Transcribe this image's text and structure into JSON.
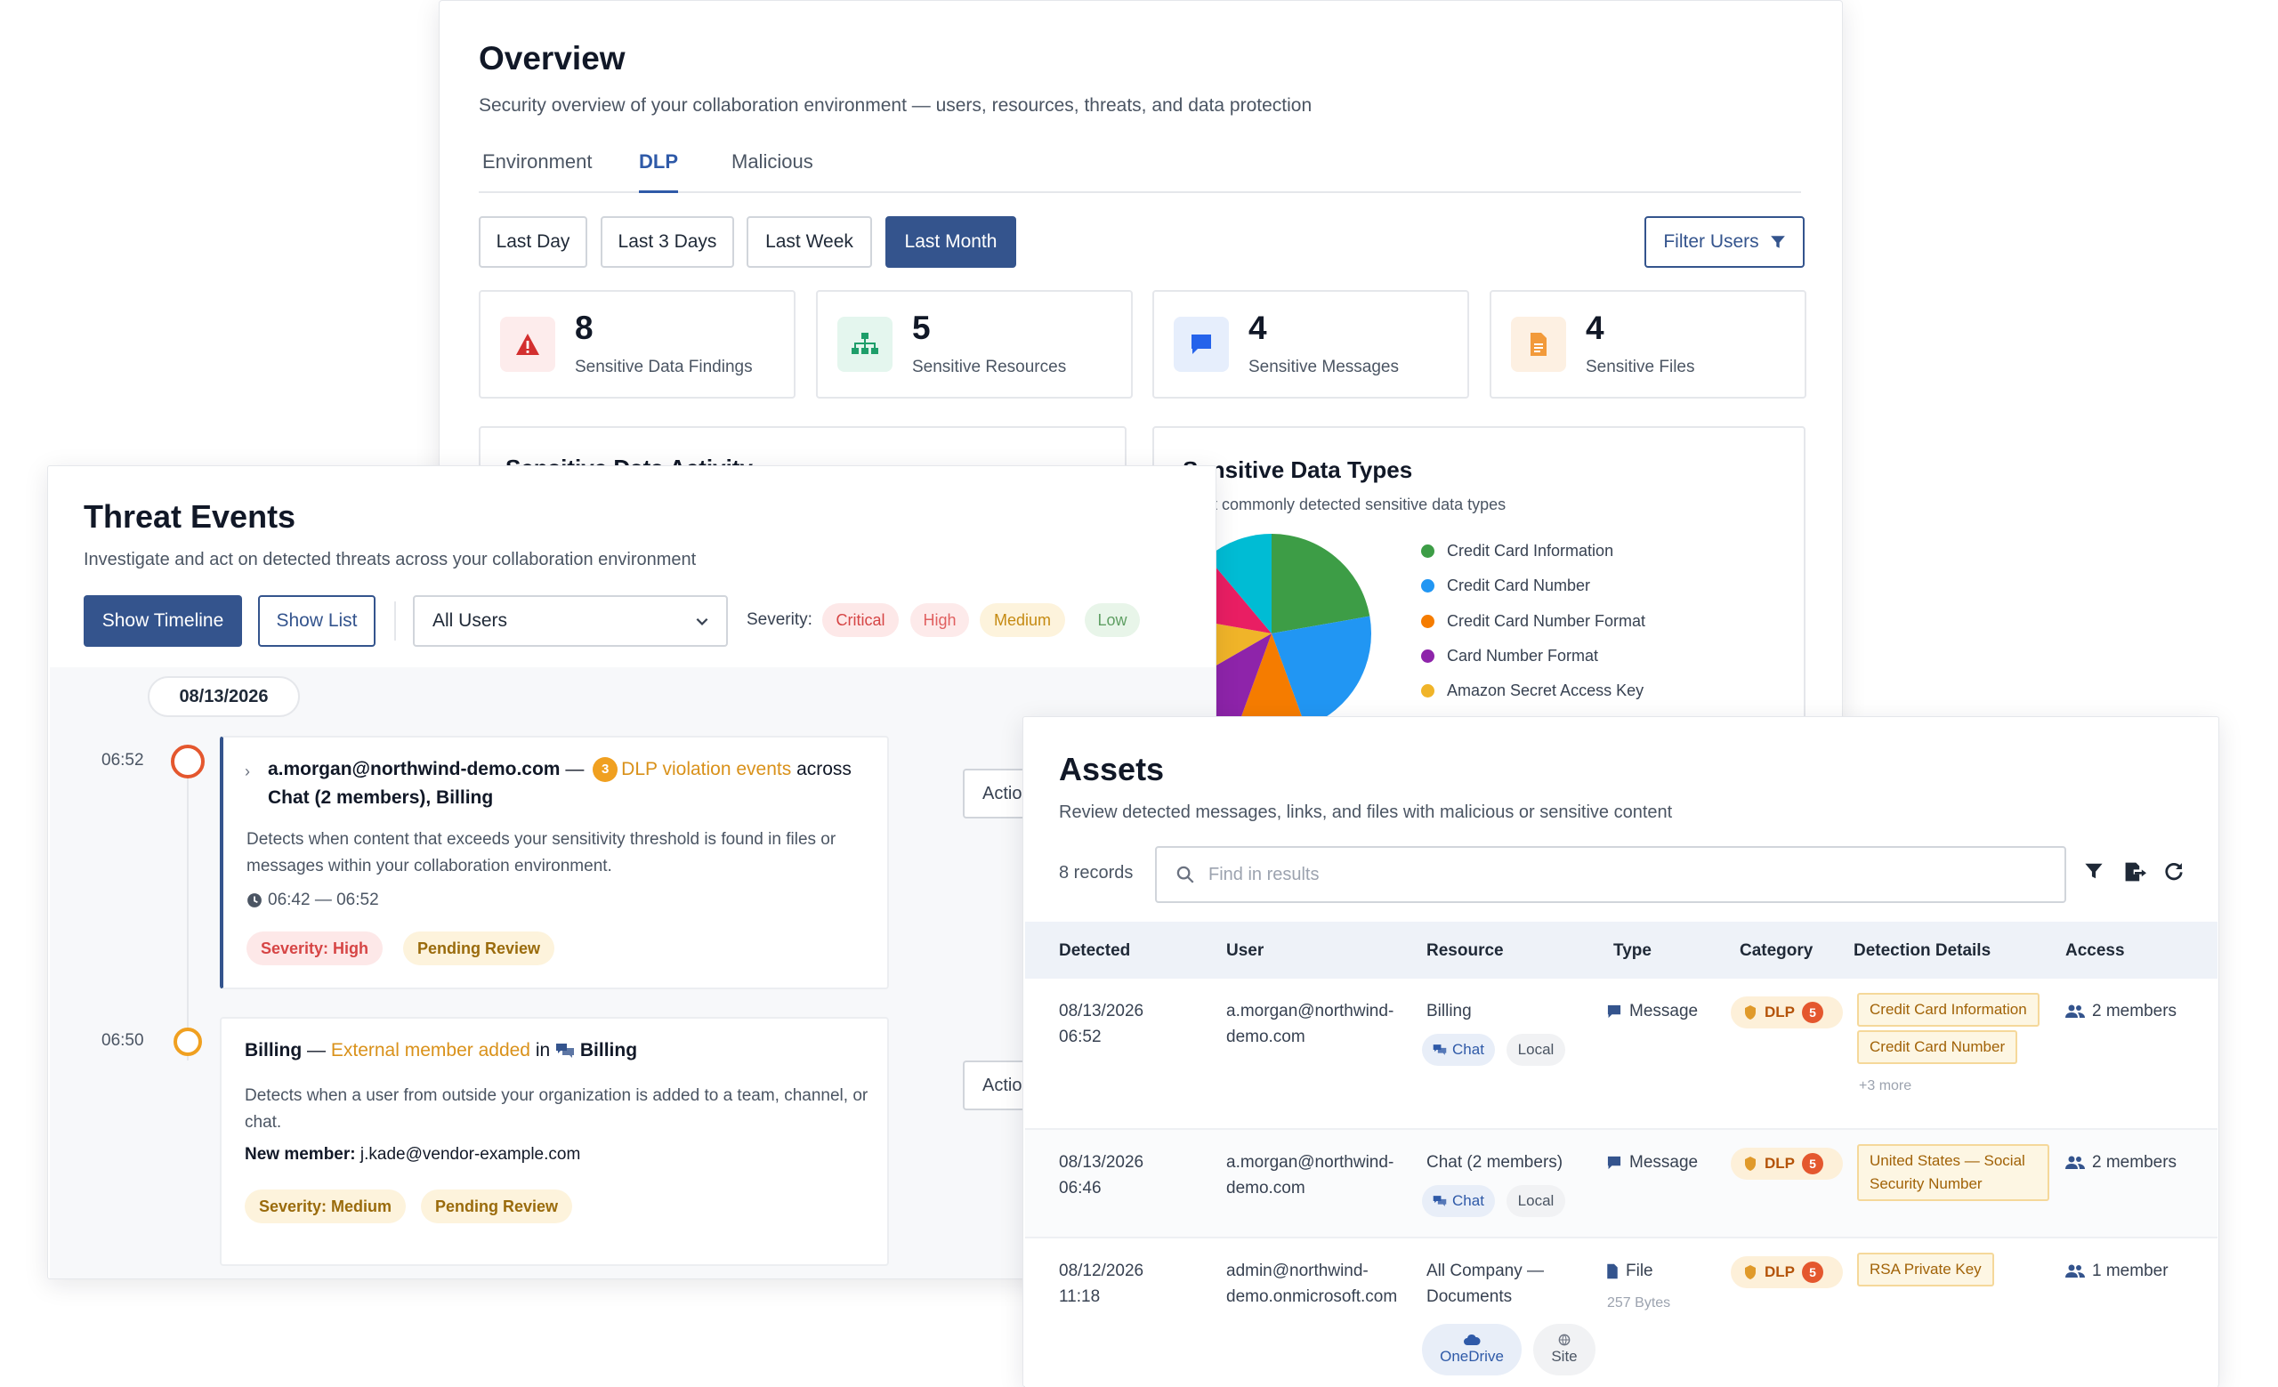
{
  "overview": {
    "title": "Overview",
    "subtitle": "Security overview of your collaboration environment — users, resources, threats, and data protection",
    "tabs": [
      {
        "label": "Environment"
      },
      {
        "label": "DLP"
      },
      {
        "label": "Malicious"
      }
    ],
    "active_tab": "DLP",
    "ranges": [
      {
        "label": "Last Day"
      },
      {
        "label": "Last 3 Days"
      },
      {
        "label": "Last Week"
      },
      {
        "label": "Last Month"
      }
    ],
    "active_range": "Last Month",
    "filter_label": "Filter Users",
    "stats": [
      {
        "value": "8",
        "label": "Sensitive Data Findings",
        "icon": "warning-icon",
        "color": "#d32f2f"
      },
      {
        "value": "5",
        "label": "Sensitive Resources",
        "icon": "sitemap-icon",
        "color": "#1e9e6a"
      },
      {
        "value": "4",
        "label": "Sensitive Messages",
        "icon": "message-icon",
        "color": "#2563eb"
      },
      {
        "value": "4",
        "label": "Sensitive Files",
        "icon": "file-icon",
        "color": "#f29a3a"
      }
    ],
    "activity_card": {
      "title": "Sensitive Data Activity"
    },
    "types_card": {
      "title": "Sensitive Data Types",
      "subtitle": "Most commonly detected sensitive data types"
    }
  },
  "chart_data": {
    "type": "pie",
    "title": "Sensitive Data Types",
    "legend": [
      {
        "name": "Credit Card Information",
        "color": "#3d9d46"
      },
      {
        "name": "Credit Card Number",
        "color": "#2196f3"
      },
      {
        "name": "Credit Card Number Format",
        "color": "#f57c00"
      },
      {
        "name": "Card Number Format",
        "color": "#8e24aa"
      },
      {
        "name": "Amazon Secret Access Key",
        "color": "#f0b429"
      }
    ],
    "slices": [
      {
        "name": "Credit Card Information",
        "value": 2,
        "color": "#3d9d46"
      },
      {
        "name": "Credit Card Number",
        "value": 2,
        "color": "#2196f3"
      },
      {
        "name": "Credit Card Number Format",
        "value": 1,
        "color": "#f57c00"
      },
      {
        "name": "Card Number Format",
        "value": 1,
        "color": "#8e24aa"
      },
      {
        "name": "Amazon Secret Access Key",
        "value": 1,
        "color": "#f0b429"
      },
      {
        "value": 1,
        "color": "#e91e63"
      },
      {
        "value": 1,
        "color": "#00bcd4"
      }
    ],
    "legend_position": "right"
  },
  "threats": {
    "title": "Threat Events",
    "subtitle": "Investigate and act on detected threats across your collaboration environment",
    "show_timeline": "Show Timeline",
    "show_list": "Show List",
    "user_select": "All Users",
    "severity_label": "Severity:",
    "severities": [
      {
        "label": "Critical",
        "bg": "#fde8e8",
        "fg": "#d64545"
      },
      {
        "label": "High",
        "bg": "#fdeaea",
        "fg": "#e06060"
      },
      {
        "label": "Medium",
        "bg": "#fdf3dc",
        "fg": "#c58a12"
      },
      {
        "label": "Low",
        "bg": "#e8f5e9",
        "fg": "#5f9f63"
      }
    ],
    "date": "08/13/2026",
    "events": [
      {
        "time": "06:52",
        "user": "a.morgan@northwind-demo.com",
        "dash": "—",
        "count": "3",
        "event_type": "DLP violation events",
        "across": "across",
        "targets": "Chat (2 members), Billing",
        "description": "Detects when content that exceeds your sensitivity threshold is found in files or messages within your collaboration environment.",
        "range": "06:42 — 06:52",
        "severity": "Severity: High",
        "status": "Pending Review",
        "action": "Actions"
      },
      {
        "time": "06:50",
        "source": "Billing",
        "dash": "—",
        "event_type": "External member added",
        "in": "in",
        "target": "Billing",
        "description": "Detects when a user from outside your organization is added to a team, channel, or chat.",
        "member_label": "New member:",
        "member": "j.kade@vendor-example.com",
        "severity": "Severity: Medium",
        "status": "Pending Review",
        "action": "Actions"
      }
    ]
  },
  "assets": {
    "title": "Assets",
    "subtitle": "Review detected messages, links, and files with malicious or sensitive content",
    "records": "8 records",
    "search_placeholder": "Find in results",
    "columns": [
      "Detected",
      "User",
      "Resource",
      "Type",
      "Category",
      "Detection Details",
      "Access"
    ],
    "rows": [
      {
        "date": "08/13/2026",
        "time": "06:52",
        "user1": "a.morgan@northwind-",
        "user2": "demo.com",
        "resource": "Billing",
        "chip1": "Chat",
        "chip2": "Local",
        "type": "Message",
        "category": "DLP",
        "count": "5",
        "details": [
          "Credit Card Information",
          "Credit Card Number"
        ],
        "more": "+3 more",
        "access": "2 members"
      },
      {
        "date": "08/13/2026",
        "time": "06:46",
        "user1": "a.morgan@northwind-",
        "user2": "demo.com",
        "resource": "Chat (2 members)",
        "chip1": "Chat",
        "chip2": "Local",
        "type": "Message",
        "category": "DLP",
        "count": "5",
        "details": [
          "United States — Social Security Number"
        ],
        "access": "2 members"
      },
      {
        "date": "08/12/2026",
        "time": "11:18",
        "user1": "admin@northwind-",
        "user2": "demo.onmicrosoft.com",
        "resource1": "All Company —",
        "resource2": "Documents",
        "chip1": "OneDrive",
        "chip2": "Site",
        "type": "File",
        "size": "257 Bytes",
        "category": "DLP",
        "count": "5",
        "details": [
          "RSA Private Key"
        ],
        "access": "1 member"
      }
    ]
  }
}
